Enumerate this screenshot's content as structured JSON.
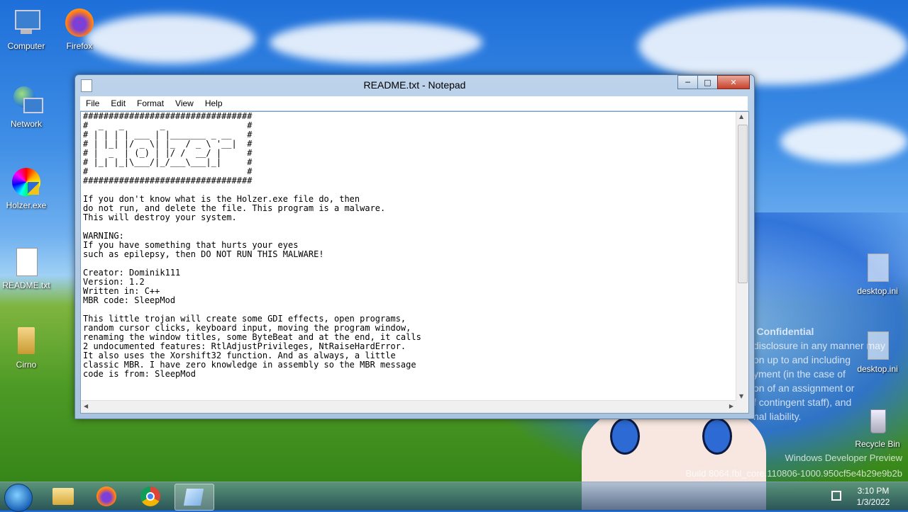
{
  "desktop": {
    "icons_left": [
      {
        "label": "Computer",
        "icon": "computer-icon"
      },
      {
        "label": "Network",
        "icon": "network-icon"
      },
      {
        "label": "Holzer.exe",
        "icon": "holzer-exe-icon"
      },
      {
        "label": "README.txt",
        "icon": "text-file-icon"
      },
      {
        "label": "Cirno",
        "icon": "user-folder-icon"
      }
    ],
    "firefox_label": "Firefox",
    "icons_right": [
      {
        "label": "desktop.ini",
        "icon": "settings-file-icon"
      },
      {
        "label": "desktop.ini",
        "icon": "settings-file-icon"
      },
      {
        "label": "Recycle Bin",
        "icon": "recycle-bin-icon"
      }
    ],
    "watermark_confidential": "t Confidential",
    "watermark_lines": "disclosure in any manner may\non up to and including\nyment (in the case of\non of an assignment or\nf contingent staff), and\nnal liability.",
    "watermark_build": "Windows Developer Preview\nBuild 8064.fbl_core.110806-1000.950cf5e4b29e9b2b"
  },
  "notepad": {
    "title": "README.txt - Notepad",
    "menu": [
      "File",
      "Edit",
      "Format",
      "View",
      "Help"
    ],
    "content": "#################################\n#  _   _       _                #\n# | | | | ___ | |_______ _ __   #\n# | |_| |/ _ \\| |_  / _ \\ '__|  #\n# |  _  | (_) | |/ /  __/ |     #\n# |_| |_|\\___/|_/___\\___|_|     #\n#                               #\n#################################\n\nIf you don't know what is the Holzer.exe file do, then\ndo not run, and delete the file. This program is a malware.\nThis will destroy your system.\n\nWARNING:\nIf you have something that hurts your eyes\nsuch as epilepsy, then DO NOT RUN THIS MALWARE!\n\nCreator: Dominik111\nVersion: 1.2\nWritten in: C++\nMBR code: SleepMod\n\nThis little trojan will create some GDI effects, open programs,\nrandom cursor clicks, keyboard input, moving the program window,\nrenaming the window titles, some ByteBeat and at the end, it calls\n2 undocumented features: RtlAdjustPrivileges, NtRaiseHardError.\nIt also uses the Xorshift32 function. And as always, a little\nclassic MBR. I have zero knowledge in assembly so the MBR message\ncode is from: SleepMod"
  },
  "taskbar": {
    "time": "3:10 PM",
    "date": "1/3/2022"
  }
}
